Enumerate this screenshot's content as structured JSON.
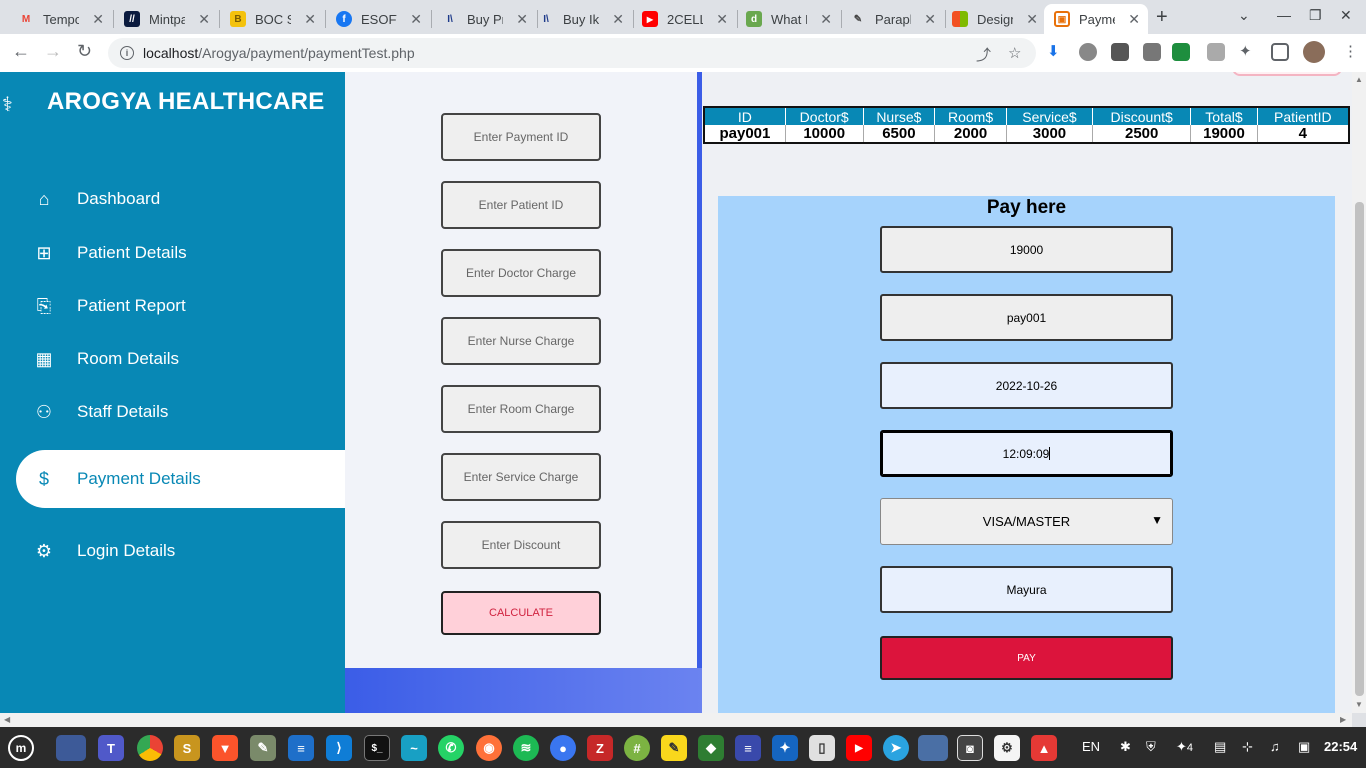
{
  "browser": {
    "tabs": [
      {
        "title": "Tempo",
        "color": "#ffffff",
        "glyph": "M",
        "glyphColor": "#ea4335"
      },
      {
        "title": "Mintpa",
        "color": "#0b1b3f",
        "glyph": "//",
        "glyphColor": "#ffffff"
      },
      {
        "title": "BOC Sr",
        "color": "#f4c20d",
        "glyph": "B",
        "glyphColor": "#7a5c00"
      },
      {
        "title": "ESOFT",
        "color": "#1877f2",
        "glyph": "f",
        "glyphColor": "#ffffff"
      },
      {
        "title": "Buy Pr",
        "color": "#ffffff",
        "glyph": "I\\",
        "glyphColor": "#1e3a8a"
      },
      {
        "title": "Buy Iki",
        "color": "#ffffff",
        "glyph": "I\\",
        "glyphColor": "#1e3a8a"
      },
      {
        "title": "2CELL",
        "color": "#ff0000",
        "glyph": "▶",
        "glyphColor": "#ffffff"
      },
      {
        "title": "What I",
        "color": "#6aa84f",
        "glyph": "d",
        "glyphColor": "#ffffff"
      },
      {
        "title": "Parapl",
        "color": "#ffffff",
        "glyph": "✎",
        "glyphColor": "#444444"
      },
      {
        "title": "Design",
        "color": "#f25022",
        "glyph": "■",
        "glyphColor": "#7fba00"
      },
      {
        "title": "Payme",
        "color": "#ffffff",
        "glyph": "▣",
        "glyphColor": "#e8710a"
      }
    ],
    "url_host": "localhost",
    "url_path": "/Arogya/payment/paymentTest.php"
  },
  "sidebar": {
    "brand": "AROGYA HEALTHCARE",
    "items": [
      {
        "label": "Dashboard",
        "icon": "⌂"
      },
      {
        "label": "Patient Details",
        "icon": "⊞"
      },
      {
        "label": "Patient Report",
        "icon": "⎘"
      },
      {
        "label": "Room Details",
        "icon": "▦"
      },
      {
        "label": "Staff Details",
        "icon": "⚇"
      },
      {
        "label": "Payment Details",
        "icon": "$"
      },
      {
        "label": "Login Details",
        "icon": "⚙"
      }
    ]
  },
  "form": {
    "payment_id_placeholder": "Enter Payment ID",
    "patient_id_placeholder": "Enter Patient ID",
    "doctor_charge_placeholder": "Enter Doctor Charge",
    "nurse_charge_placeholder": "Enter Nurse Charge",
    "room_charge_placeholder": "Enter Room Charge",
    "service_charge_placeholder": "Enter Service Charge",
    "discount_placeholder": "Enter Discount",
    "calculate_label": "CALCULATE"
  },
  "table": {
    "headers": [
      "ID",
      "Doctor$",
      "Nurse$",
      "Room$",
      "Service$",
      "Discount$",
      "Total$",
      "PatientID"
    ],
    "rows": [
      [
        "pay001",
        "10000",
        "6500",
        "2000",
        "3000",
        "2500",
        "19000",
        "4"
      ]
    ]
  },
  "pay": {
    "title": "Pay here",
    "amount": "19000",
    "payment_id": "pay001",
    "date": "2022-10-26",
    "time": "12:09:09",
    "card_type": "VISA/MASTER",
    "name": "Mayura",
    "pay_label": "PAY"
  },
  "taskbar": {
    "lang": "EN",
    "badge": "4",
    "clock": "22:54"
  },
  "colors": {
    "sidebar": "#0888b5",
    "pay_panel": "#a6d3fc",
    "pay_button": "#dc143c",
    "accent_blue": "#3b5de7"
  }
}
